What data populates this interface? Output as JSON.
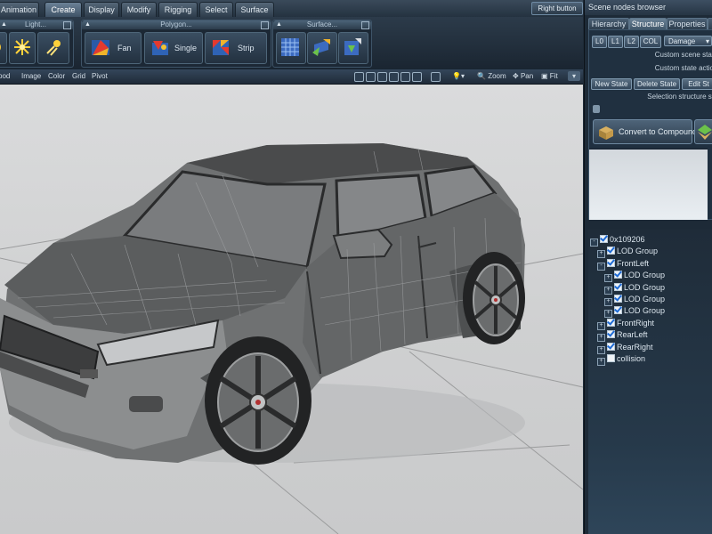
{
  "menu": {
    "tabs": [
      "Animation",
      "Create",
      "Display",
      "Modify",
      "Rigging",
      "Select",
      "Surface"
    ],
    "active": "Create",
    "right_button": "Right button"
  },
  "ribbon": {
    "light_group": "Light...",
    "polygon_group": "Polygon...",
    "surface_group": "Surface...",
    "fan": "Fan",
    "single": "Single",
    "strip": "Strip"
  },
  "viewport_menu": {
    "items": [
      "pod",
      "Image",
      "Color",
      "Grid",
      "Pivot"
    ],
    "zoom": "Zoom",
    "pan": "Pan",
    "fit": "Fit"
  },
  "panel": {
    "title": "Scene nodes browser",
    "tabs": [
      "Hierarchy",
      "Structure",
      "Properties"
    ],
    "active_tab": "Structure",
    "lod_buttons": [
      "L0",
      "L1",
      "L2",
      "COL"
    ],
    "damage": "Damage",
    "custom_scene": "Custom scene stat",
    "custom_state": "Custom state actio",
    "new_state": "New State",
    "delete_state": "Delete State",
    "edit_state": "Edit St",
    "selection_structure": "Selection structure st",
    "convert": "Convert to Compound"
  },
  "tree": [
    {
      "label": "0x109206",
      "level": 0,
      "checked": true,
      "expander": "-"
    },
    {
      "label": "LOD Group",
      "level": 1,
      "checked": true,
      "expander": "+"
    },
    {
      "label": "FrontLeft",
      "level": 1,
      "checked": true,
      "expander": "-"
    },
    {
      "label": "LOD Group",
      "level": 2,
      "checked": true,
      "expander": "+"
    },
    {
      "label": "LOD Group",
      "level": 2,
      "checked": true,
      "expander": "+"
    },
    {
      "label": "LOD Group",
      "level": 2,
      "checked": true,
      "expander": "+"
    },
    {
      "label": "LOD Group",
      "level": 2,
      "checked": true,
      "expander": "+"
    },
    {
      "label": "FrontRight",
      "level": 1,
      "checked": true,
      "expander": "+"
    },
    {
      "label": "RearLeft",
      "level": 1,
      "checked": true,
      "expander": "+"
    },
    {
      "label": "RearRight",
      "level": 1,
      "checked": true,
      "expander": "+"
    },
    {
      "label": "collision",
      "level": 1,
      "checked": false,
      "expander": "+"
    }
  ],
  "colors": {
    "accent": "#4b6378",
    "viewport_bg": "#d4d5d6",
    "check_blue": "#1e6bd6"
  }
}
